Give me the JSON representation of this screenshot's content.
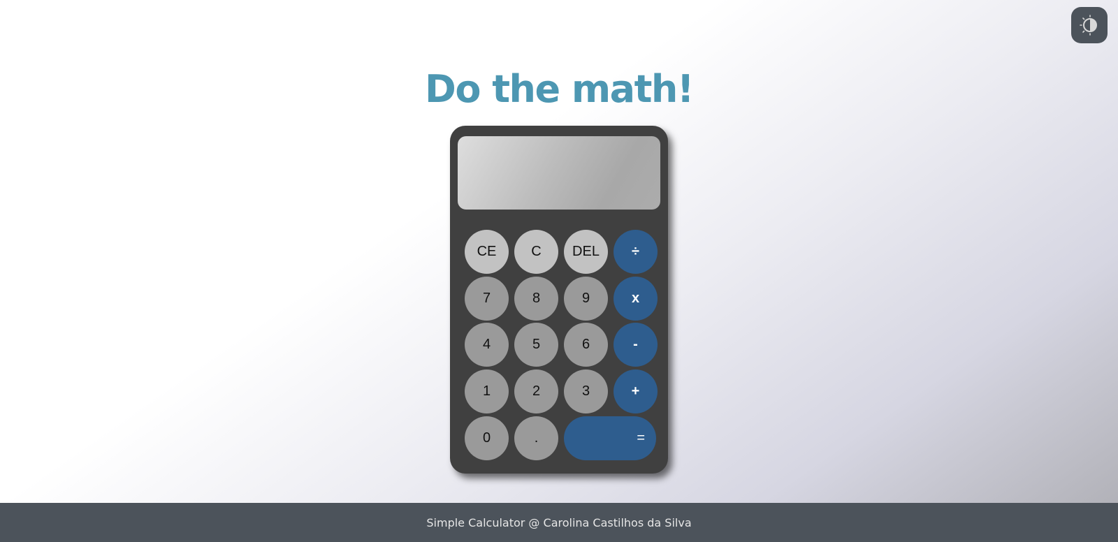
{
  "header": {
    "theme_toggle_icon": "contrast-theme-icon"
  },
  "main": {
    "title": "Do the math!"
  },
  "calculator": {
    "display": "",
    "keys": {
      "ce": "CE",
      "c": "C",
      "del": "DEL",
      "divide": "÷",
      "seven": "7",
      "eight": "8",
      "nine": "9",
      "multiply": "x",
      "four": "4",
      "five": "5",
      "six": "6",
      "minus": "-",
      "one": "1",
      "two": "2",
      "three": "3",
      "plus": "+",
      "zero": "0",
      "dot": ".",
      "equals": "="
    },
    "colors": {
      "body": "#404040",
      "function_key": "#c2c2c2",
      "number_key": "#9a9a9a",
      "operator_key": "#2e5d8e"
    }
  },
  "footer": {
    "text": "Simple Calculator @ Carolina Castilhos da Silva"
  },
  "colors": {
    "title": "#4d97b2",
    "footer_bg": "#4c535b"
  }
}
